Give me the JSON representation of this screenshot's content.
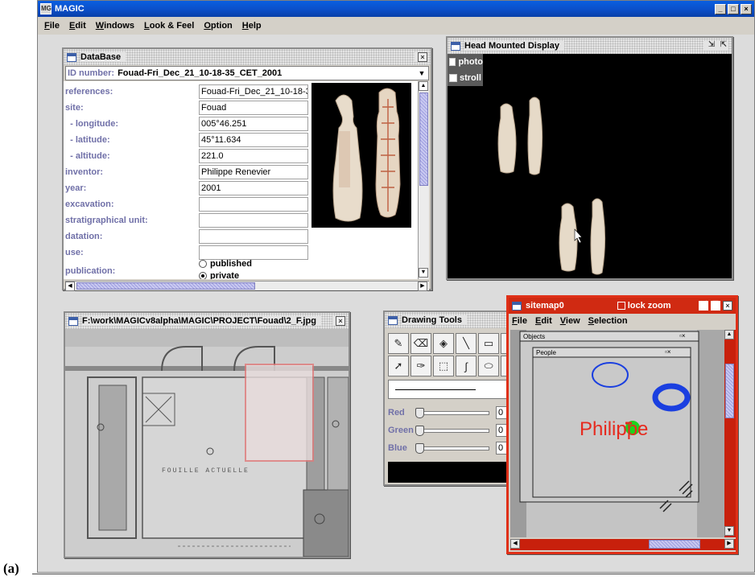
{
  "app": {
    "title": "MAGIC",
    "icon_text": "MG",
    "window_controls": [
      "_",
      "□",
      "×"
    ],
    "menu": [
      "File",
      "Edit",
      "Windows",
      "Look & Feel",
      "Option",
      "Help"
    ]
  },
  "database": {
    "title": "DataBase",
    "close": "×",
    "id_label": "ID number:",
    "id_value": "Fouad-Fri_Dec_21_10-18-35_CET_2001",
    "rows": [
      {
        "key": "references:",
        "value": "Fouad-Fri_Dec_21_10-18-3"
      },
      {
        "key": "site:",
        "value": "Fouad"
      },
      {
        "key": "  - longitude:",
        "value": "005°46.251"
      },
      {
        "key": "  - latitude:",
        "value": "45°11.634"
      },
      {
        "key": "  - altitude:",
        "value": "221.0"
      },
      {
        "key": "inventor:",
        "value": "Philippe Renevier"
      },
      {
        "key": "year:",
        "value": "2001"
      },
      {
        "key": "excavation:",
        "value": ""
      },
      {
        "key": "stratigraphical unit:",
        "value": ""
      },
      {
        "key": "datation:",
        "value": ""
      },
      {
        "key": "use:",
        "value": ""
      }
    ],
    "publication_label": "publication:",
    "publication_options": [
      {
        "label": "published",
        "selected": false
      },
      {
        "label": "private",
        "selected": true
      }
    ]
  },
  "hmd": {
    "title": "Head Mounted Display",
    "checkboxes": [
      {
        "label": "photo",
        "checked": false
      },
      {
        "label": "stroll",
        "checked": false
      }
    ]
  },
  "image_viewer": {
    "title": "F:\\work\\MAGICv8alpha\\MAGIC\\PROJECT\\Fouad\\2_F.jpg",
    "close": "×",
    "plan_text": "FOUILLE    ACTUELLE"
  },
  "drawing_tools": {
    "title": "Drawing Tools",
    "tools": [
      {
        "name": "pencil",
        "glyph": "✎"
      },
      {
        "name": "eraser",
        "glyph": "⌫"
      },
      {
        "name": "fill",
        "glyph": "◈"
      },
      {
        "name": "line",
        "glyph": "╲"
      },
      {
        "name": "rectangle",
        "glyph": "▭"
      },
      {
        "name": "polygon",
        "glyph": "▱"
      },
      {
        "name": "select",
        "glyph": "➚"
      },
      {
        "name": "picker",
        "glyph": "✑"
      },
      {
        "name": "marquee",
        "glyph": "⬚"
      },
      {
        "name": "freehand",
        "glyph": "∫"
      },
      {
        "name": "ellipse",
        "glyph": "⬭"
      },
      {
        "name": "rounded-rect",
        "glyph": "▢"
      }
    ],
    "sliders": [
      {
        "label": "Red",
        "value": "0"
      },
      {
        "label": "Green",
        "value": "0"
      },
      {
        "label": "Blue",
        "value": "0"
      }
    ]
  },
  "sitemap": {
    "title": "sitemap0",
    "lock_zoom": "lock zoom",
    "menu": [
      "File",
      "Edit",
      "View",
      "Selection"
    ],
    "layer_objects": "Objects",
    "layer_people": "People",
    "person_label": "Philippe",
    "colors": {
      "frame": "#e03018",
      "person": "#e62a1e",
      "blue_marker": "#1a3fe0",
      "green_marker": "#1fd21f"
    }
  },
  "caption": "(a)"
}
